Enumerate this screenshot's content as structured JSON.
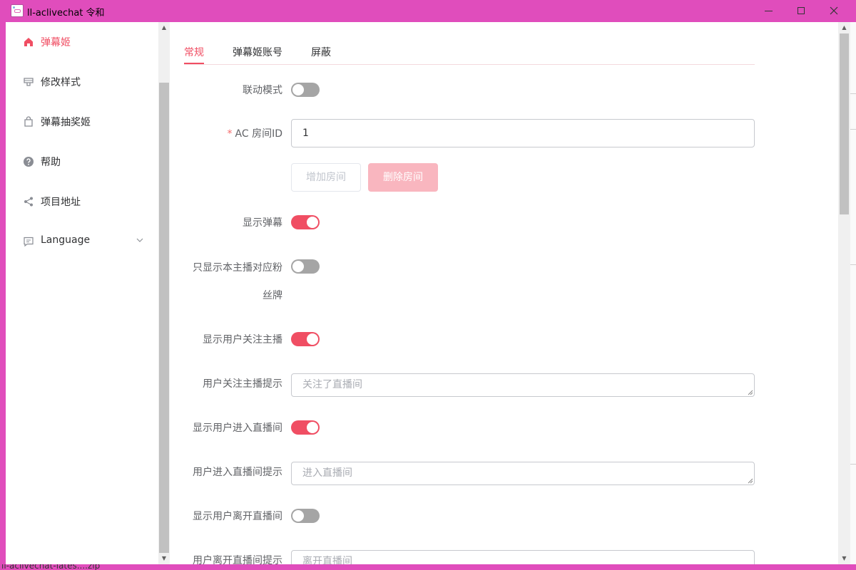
{
  "window": {
    "title": "ll-aclivechat 令和",
    "taskbar_text": "ll-aclivechat-lates....zip"
  },
  "sidebar": {
    "items": [
      {
        "label": "弹幕姬",
        "icon": "home-icon",
        "active": true
      },
      {
        "label": "修改样式",
        "icon": "brush-icon",
        "active": false
      },
      {
        "label": "弹幕抽奖姬",
        "icon": "shopping-bag-icon",
        "active": false
      },
      {
        "label": "帮助",
        "icon": "question-icon",
        "active": false
      },
      {
        "label": "项目地址",
        "icon": "share-icon",
        "active": false
      },
      {
        "label": "Language",
        "icon": "chat-icon",
        "active": false
      }
    ]
  },
  "tabs": [
    {
      "label": "常规",
      "active": true
    },
    {
      "label": "弹幕姬账号",
      "active": false
    },
    {
      "label": "屏蔽",
      "active": false
    }
  ],
  "form": {
    "linkage_mode": {
      "label": "联动模式",
      "on": false
    },
    "room_id": {
      "label": "AC 房间ID",
      "required_mark": "*",
      "value": "1"
    },
    "add_room_label": "增加房间",
    "delete_room_label": "删除房间",
    "show_danmaku": {
      "label": "显示弹幕",
      "on": true
    },
    "only_fan_medal": {
      "label_line1": "只显示本主播对应粉",
      "label_line2": "丝牌",
      "on": false
    },
    "show_follow": {
      "label": "显示用户关注主播",
      "on": true
    },
    "follow_tip": {
      "label": "用户关注主播提示",
      "placeholder": "关注了直播间"
    },
    "show_enter": {
      "label": "显示用户进入直播间",
      "on": true
    },
    "enter_tip": {
      "label": "用户进入直播间提示",
      "placeholder": "进入直播间"
    },
    "show_leave": {
      "label": "显示用户离开直播间",
      "on": false
    },
    "leave_tip": {
      "label": "用户离开直播间提示",
      "placeholder": "离开直播间"
    }
  },
  "colors": {
    "accent": "#f04e63",
    "titlebar": "#e04dbc",
    "switch_off": "#a5a5a5",
    "delete_button_disabled": "#f9b6bf"
  }
}
